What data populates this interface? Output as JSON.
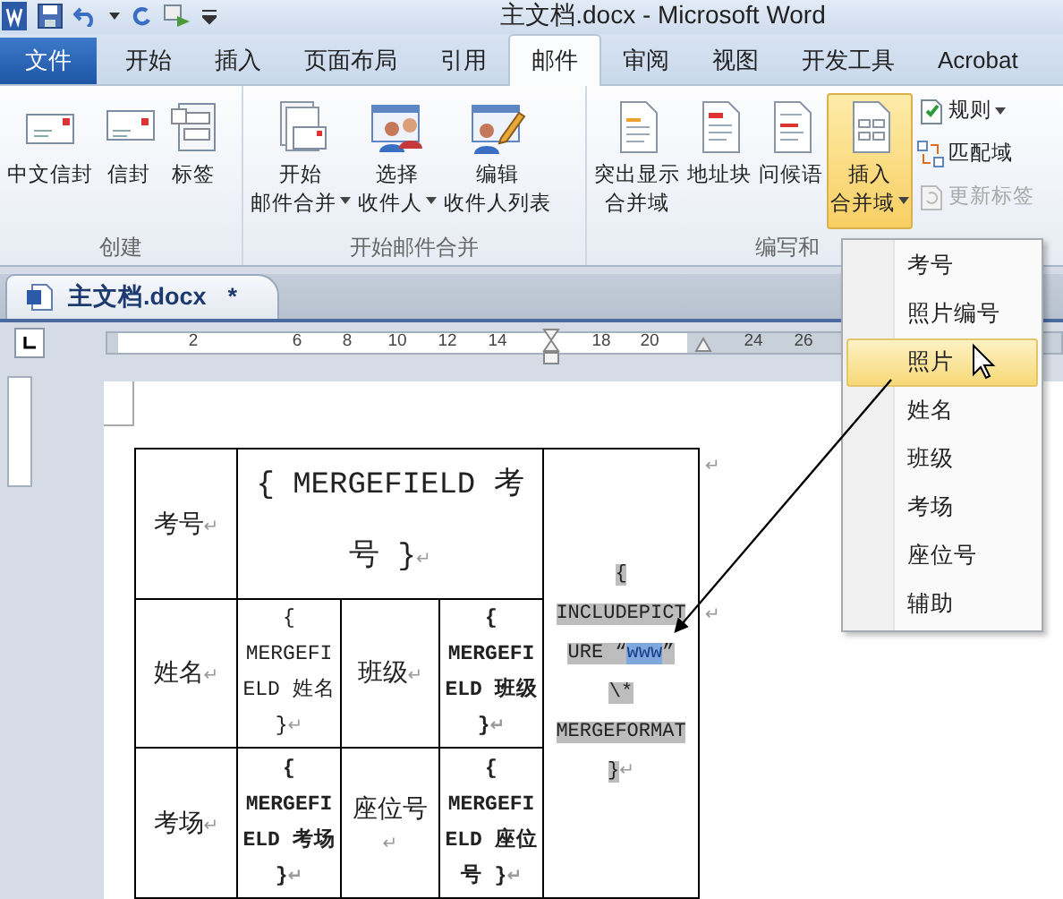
{
  "window": {
    "title": "主文档.docx - Microsoft Word"
  },
  "tabs": [
    {
      "label": "文件",
      "kind": "file",
      "selected": false
    },
    {
      "label": "开始",
      "kind": "tab",
      "selected": false
    },
    {
      "label": "插入",
      "kind": "tab",
      "selected": false
    },
    {
      "label": "页面布局",
      "kind": "tab",
      "selected": false
    },
    {
      "label": "引用",
      "kind": "tab",
      "selected": false
    },
    {
      "label": "邮件",
      "kind": "tab",
      "selected": true
    },
    {
      "label": "审阅",
      "kind": "tab",
      "selected": false
    },
    {
      "label": "视图",
      "kind": "tab",
      "selected": false
    },
    {
      "label": "开发工具",
      "kind": "tab",
      "selected": false
    },
    {
      "label": "Acrobat",
      "kind": "tab",
      "selected": false
    }
  ],
  "ribbon": {
    "groups": [
      {
        "label": "创建",
        "buttons": [
          {
            "lines": [
              "中文信封"
            ],
            "dropdown": false,
            "selected": false
          },
          {
            "lines": [
              "信封"
            ],
            "dropdown": false,
            "selected": false
          },
          {
            "lines": [
              "标签"
            ],
            "dropdown": false,
            "selected": false
          }
        ]
      },
      {
        "label": "开始邮件合并",
        "buttons": [
          {
            "lines": [
              "开始",
              "邮件合并"
            ],
            "dropdown": true,
            "selected": false
          },
          {
            "lines": [
              "选择",
              "收件人"
            ],
            "dropdown": true,
            "selected": false
          },
          {
            "lines": [
              "编辑",
              "收件人列表"
            ],
            "dropdown": false,
            "selected": false
          }
        ]
      },
      {
        "label": "编写和",
        "buttons": [
          {
            "lines": [
              "突出显示",
              "合并域"
            ],
            "dropdown": false,
            "selected": false
          },
          {
            "lines": [
              "地址块"
            ],
            "dropdown": false,
            "selected": false
          },
          {
            "lines": [
              "问候语"
            ],
            "dropdown": false,
            "selected": false
          },
          {
            "lines": [
              "插入",
              "合并域"
            ],
            "dropdown": true,
            "selected": true
          }
        ],
        "small_buttons": [
          {
            "label": "规则",
            "dropdown": true,
            "disabled": false
          },
          {
            "label": "匹配域",
            "dropdown": false,
            "disabled": false
          },
          {
            "label": "更新标签",
            "dropdown": false,
            "disabled": true
          }
        ]
      }
    ]
  },
  "document_tab": {
    "label": "主文档.docx",
    "modified": "*"
  },
  "ruler": {
    "labels": [
      "2",
      "6",
      "8",
      "10",
      "12",
      "14",
      "18",
      "20",
      "24",
      "26"
    ]
  },
  "table": {
    "cells": [
      {
        "kind": "label",
        "text": "考号",
        "mark": "↵"
      },
      {
        "kind": "field_large",
        "text": "{ MERGEFIELD 考号 }",
        "bold": false,
        "mark": "↵"
      },
      {
        "kind": "label",
        "text": "姓名",
        "mark": "↵"
      },
      {
        "kind": "field",
        "text": "{ MERGEFIELD 姓名 }",
        "bold": false,
        "mark": "↵"
      },
      {
        "kind": "label",
        "text": "班级",
        "mark": "↵"
      },
      {
        "kind": "field",
        "text": "{ MERGEFIELD 班级 }",
        "bold": true,
        "mark": "↵"
      },
      {
        "kind": "label",
        "text": "考场",
        "mark": "↵"
      },
      {
        "kind": "field",
        "text": "{ MERGEFIELD 考场 }",
        "bold": true,
        "mark": "↵"
      },
      {
        "kind": "label",
        "text": "座位号",
        "mark": "↵"
      },
      {
        "kind": "field",
        "text": "{ MERGEFIELD 座位号 }",
        "bold": true,
        "mark": "↵"
      },
      {
        "kind": "include",
        "segments": [
          {
            "text": "{ INCLUDEPICTURE “",
            "selected": false
          },
          {
            "text": "www",
            "selected": true
          },
          {
            "text": "” \\* MERGEFORMAT }",
            "selected": false
          }
        ],
        "mark": "↵"
      }
    ],
    "row_end_marks": [
      "↵",
      "↵"
    ]
  },
  "menu": {
    "items": [
      {
        "label": "考号",
        "selected": false
      },
      {
        "label": "照片编号",
        "selected": false
      },
      {
        "label": "照片",
        "selected": true
      },
      {
        "label": "姓名",
        "selected": false
      },
      {
        "label": "班级",
        "selected": false
      },
      {
        "label": "考场",
        "selected": false
      },
      {
        "label": "座位号",
        "selected": false
      },
      {
        "label": "辅助",
        "selected": false
      }
    ]
  }
}
